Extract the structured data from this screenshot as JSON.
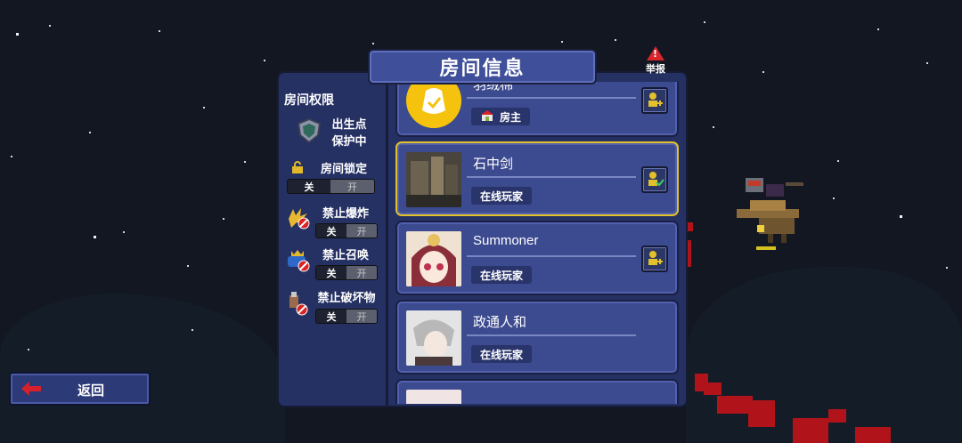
{
  "header": {
    "title": "房间信息",
    "report_label": "举报"
  },
  "permissions": {
    "title": "房间权限",
    "spawn": {
      "label_line1": "出生点",
      "label_line2": "保护中"
    },
    "items": [
      {
        "label": "房间锁定",
        "off": "关",
        "on": "开",
        "state": "off"
      },
      {
        "label": "禁止爆炸",
        "off": "关",
        "on": "开",
        "state": "off"
      },
      {
        "label": "禁止召唤",
        "off": "关",
        "on": "开",
        "state": "off"
      },
      {
        "label": "禁止破坏物",
        "off": "关",
        "on": "开",
        "state": "off"
      }
    ]
  },
  "players": [
    {
      "name": "羽绒棉",
      "role": "房主",
      "role_icon": "house-icon",
      "action": "add-friend",
      "selected": false
    },
    {
      "name": "石中剑",
      "role": "在线玩家",
      "action": "friend-added",
      "selected": true
    },
    {
      "name": "Summoner",
      "role": "在线玩家",
      "action": "add-friend",
      "selected": false
    },
    {
      "name": "政通人和",
      "role": "在线玩家",
      "action": "add-friend",
      "selected": false
    }
  ],
  "footer": {
    "back_label": "返回"
  },
  "colors": {
    "panel": "#253063",
    "card": "#3c4a8f",
    "selected_border": "#e3c12b",
    "title_bar": "#3f4f9a"
  }
}
